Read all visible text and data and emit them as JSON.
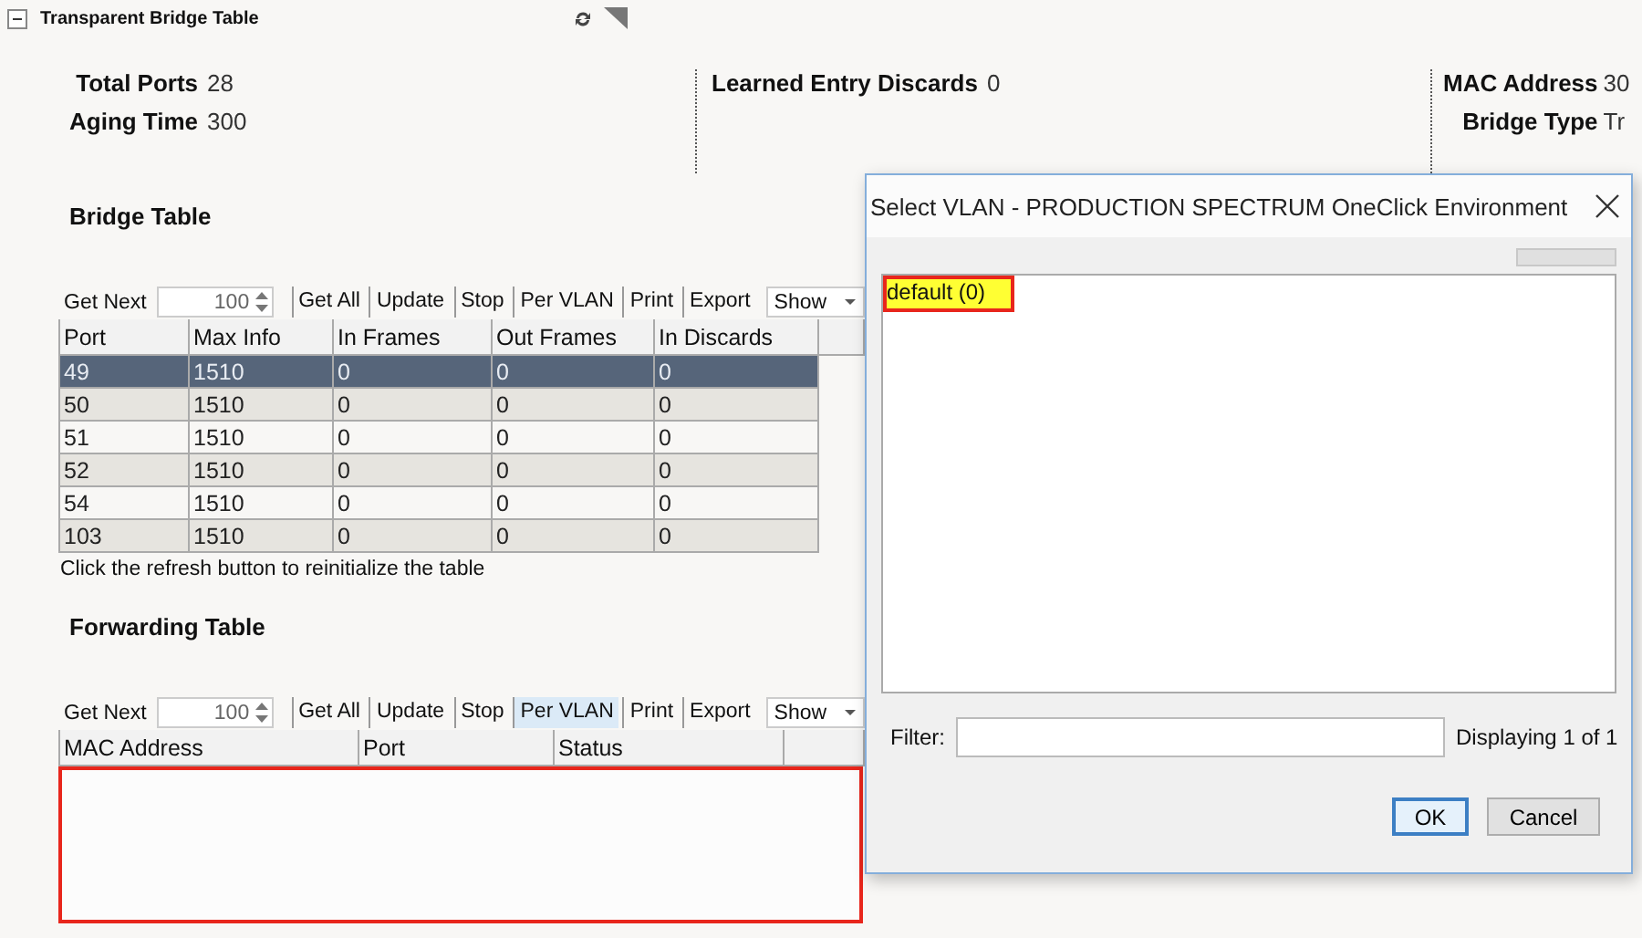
{
  "panel": {
    "title": "Transparent Bridge Table",
    "expanded": true
  },
  "stat_groups": [
    [
      {
        "label": "Total Ports",
        "value": "28"
      },
      {
        "label": "Aging Time",
        "value": "300"
      }
    ],
    [
      {
        "label": "Learned Entry Discards",
        "value": "0"
      }
    ],
    [
      {
        "label": "MAC Address",
        "value": "30"
      },
      {
        "label": "Bridge Type",
        "value": "Tr"
      }
    ]
  ],
  "bridge_table": {
    "heading": "Bridge Table",
    "toolbar": {
      "get_next_label": "Get Next",
      "spin_value": "100",
      "buttons": [
        {
          "label": "Get All",
          "highlighted": false
        },
        {
          "label": "Update",
          "highlighted": false
        },
        {
          "label": "Stop",
          "highlighted": false
        },
        {
          "label": "Per VLAN",
          "highlighted": false
        },
        {
          "label": "Print",
          "highlighted": false
        },
        {
          "label": "Export",
          "highlighted": false
        }
      ],
      "dropdown": "Show"
    },
    "columns": [
      "Port",
      "Max Info",
      "In Frames",
      "Out Frames",
      "In Discards"
    ],
    "rows": [
      {
        "cells": [
          "49",
          "1510",
          "0",
          "0",
          "0"
        ],
        "selected": true
      },
      {
        "cells": [
          "50",
          "1510",
          "0",
          "0",
          "0"
        ],
        "selected": false
      },
      {
        "cells": [
          "51",
          "1510",
          "0",
          "0",
          "0"
        ],
        "selected": false
      },
      {
        "cells": [
          "52",
          "1510",
          "0",
          "0",
          "0"
        ],
        "selected": false
      },
      {
        "cells": [
          "54",
          "1510",
          "0",
          "0",
          "0"
        ],
        "selected": false
      },
      {
        "cells": [
          "103",
          "1510",
          "0",
          "0",
          "0"
        ],
        "selected": false
      }
    ],
    "note": "Click the refresh button to reinitialize the table"
  },
  "forwarding_table": {
    "heading": "Forwarding Table",
    "toolbar": {
      "get_next_label": "Get Next",
      "spin_value": "100",
      "buttons": [
        {
          "label": "Get All",
          "highlighted": false
        },
        {
          "label": "Update",
          "highlighted": false
        },
        {
          "label": "Stop",
          "highlighted": false
        },
        {
          "label": "Per VLAN",
          "highlighted": true
        },
        {
          "label": "Print",
          "highlighted": false
        },
        {
          "label": "Export",
          "highlighted": false
        }
      ],
      "dropdown": "Show"
    },
    "columns": [
      "MAC Address",
      "Port",
      "Status"
    ],
    "annotated": true
  },
  "dialog": {
    "title": "Select VLAN - PRODUCTION SPECTRUM OneClick Environment",
    "items": [
      {
        "label": "default (0)",
        "selected": true,
        "annotated": true
      }
    ],
    "filter_label": "Filter:",
    "count_text": "Displaying 1 of 1",
    "buttons": [
      {
        "label": "OK",
        "default": true
      },
      {
        "label": "Cancel",
        "default": false
      }
    ]
  }
}
